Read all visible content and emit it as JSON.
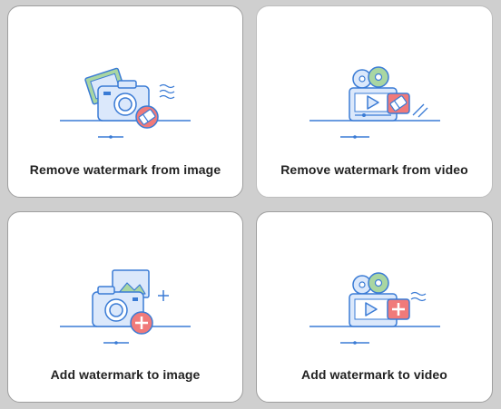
{
  "cards": [
    {
      "label": "Remove watermark from image",
      "icon": "camera-eraser-icon",
      "action": "remove",
      "media": "image"
    },
    {
      "label": "Remove watermark from video",
      "icon": "video-eraser-icon",
      "action": "remove",
      "media": "video"
    },
    {
      "label": "Add watermark to image",
      "icon": "camera-plus-icon",
      "action": "add",
      "media": "image"
    },
    {
      "label": "Add watermark to video",
      "icon": "video-plus-icon",
      "action": "add",
      "media": "video"
    }
  ],
  "colors": {
    "background": "#cfcfcf",
    "card": "#ffffff",
    "outline_blue": "#3a7bd5",
    "fill_blue": "#dbe8fb",
    "accent_red": "#f07a7a",
    "accent_green": "#a9d6a2",
    "text": "#222222"
  }
}
